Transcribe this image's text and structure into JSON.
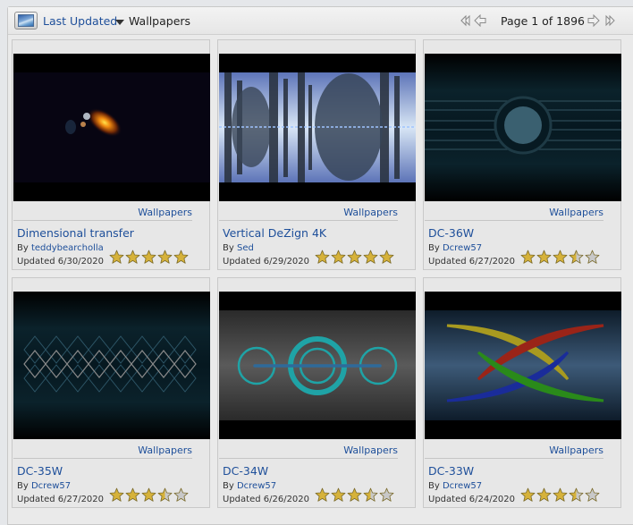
{
  "toolbar": {
    "view_icon": "picture-view-icon",
    "sort_label": "Last Updated",
    "sort_icon": "dropdown-arrow-icon",
    "category": "Wallpapers",
    "pager": {
      "first_icon": "first-page-icon",
      "prev_icon": "previous-page-icon",
      "next_icon": "next-page-icon",
      "last_icon": "last-page-icon",
      "page_text": "Page 1 of 1896",
      "current_page": 1,
      "total_pages": 1896
    }
  },
  "colors": {
    "link": "#1e4f9a",
    "star_filled": "#d6b23a",
    "star_empty": "#c8c8c8"
  },
  "items": [
    {
      "title": "Dimensional transfer",
      "by_prefix": "By ",
      "author": "teddybearcholla",
      "updated": "Updated 6/30/2020",
      "category": "Wallpapers",
      "rating": 5,
      "thumbnail": "galaxy"
    },
    {
      "title": "Vertical DeZign 4K",
      "by_prefix": "By ",
      "author": "Sed",
      "updated": "Updated 6/29/2020",
      "category": "Wallpapers",
      "rating": 5,
      "thumbnail": "fractal"
    },
    {
      "title": "DC-36W",
      "by_prefix": "By ",
      "author": "Dcrew57",
      "updated": "Updated 6/27/2020",
      "category": "Wallpapers",
      "rating": 3.5,
      "thumbnail": "circle-lines"
    },
    {
      "title": "DC-35W",
      "by_prefix": "By ",
      "author": "Dcrew57",
      "updated": "Updated 6/27/2020",
      "category": "Wallpapers",
      "rating": 3.5,
      "thumbnail": "diamonds"
    },
    {
      "title": "DC-34W",
      "by_prefix": "By ",
      "author": "Dcrew57",
      "updated": "Updated 6/26/2020",
      "category": "Wallpapers",
      "rating": 3.5,
      "thumbnail": "rings"
    },
    {
      "title": "DC-33W",
      "by_prefix": "By ",
      "author": "Dcrew57",
      "updated": "Updated 6/24/2020",
      "category": "Wallpapers",
      "rating": 3.5,
      "thumbnail": "swooshes"
    }
  ]
}
